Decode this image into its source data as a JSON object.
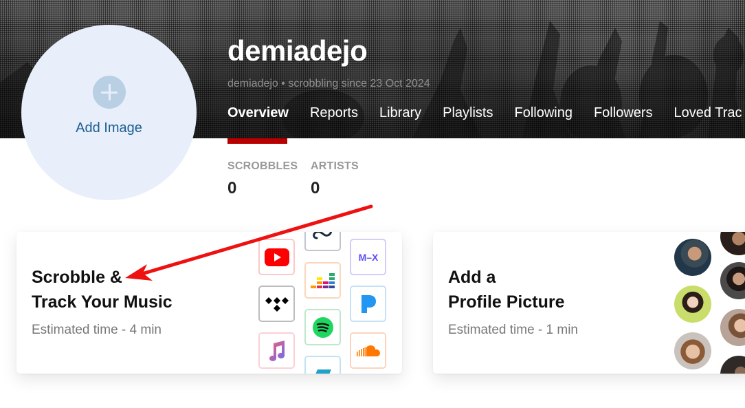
{
  "profile": {
    "username": "demiadejo",
    "subtitle": "demiadejo • scrobbling since 23 Oct 2024",
    "add_image_label": "Add Image"
  },
  "nav": {
    "tabs": [
      {
        "label": "Overview",
        "active": true
      },
      {
        "label": "Reports"
      },
      {
        "label": "Library"
      },
      {
        "label": "Playlists"
      },
      {
        "label": "Following"
      },
      {
        "label": "Followers"
      },
      {
        "label": "Loved Trac"
      }
    ],
    "accent_color": "#b90000"
  },
  "stats": [
    {
      "label": "SCROBBLES",
      "value": "0"
    },
    {
      "label": "ARTISTS",
      "value": "0"
    }
  ],
  "cards": [
    {
      "title_line1": "Scrobble &",
      "title_line2": "Track Your Music",
      "meta": "Estimated time - 4 min",
      "services": [
        "youtube-icon",
        "tidal-icon",
        "apple-music-icon",
        "unknown-service-icon",
        "deezer-icon",
        "spotify-icon",
        "partial-service-icon",
        "mx-icon",
        "pandora-icon",
        "soundcloud-icon"
      ]
    },
    {
      "title_line1": "Add a",
      "title_line2": "Profile Picture",
      "meta": "Estimated time - 1 min"
    }
  ],
  "annotation": {
    "type": "arrow",
    "color": "#ee1111"
  }
}
